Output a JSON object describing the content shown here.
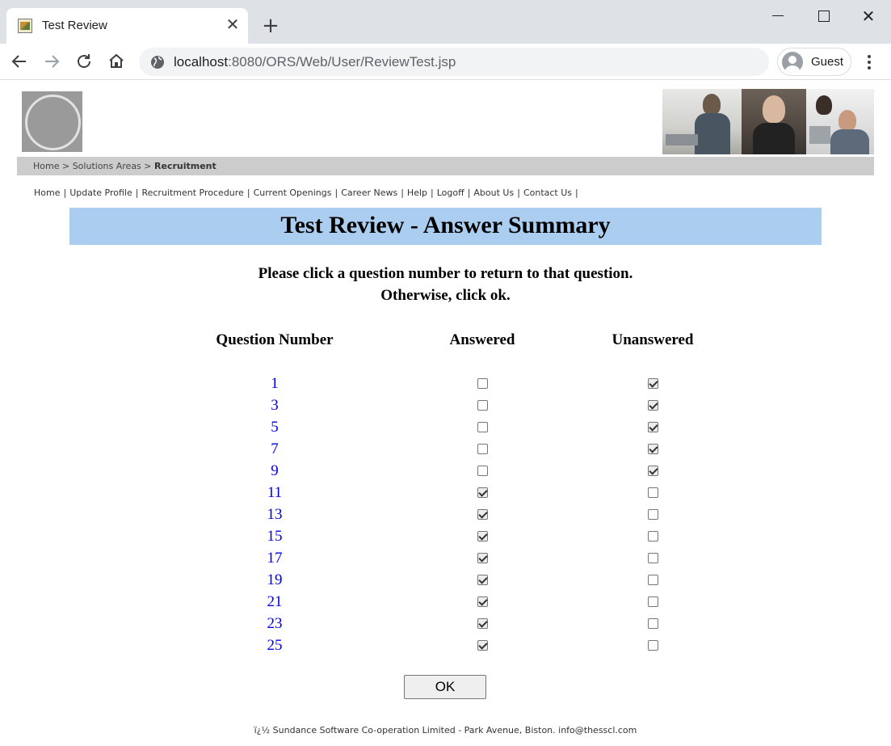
{
  "browser": {
    "tab_title": "Test Review",
    "tab_close": "✕",
    "new_tab": "+",
    "url_host": "localhost",
    "url_rest": ":8080/ORS/Web/User/ReviewTest.jsp",
    "profile_label": "Guest",
    "window_close": "✕"
  },
  "breadcrumb": {
    "home": "Home",
    "separator": ">",
    "solutions": "Solutions Areas",
    "current": "Recruitment"
  },
  "nav": {
    "items": [
      "Home",
      "Update Profile",
      "Recruitment Procedure",
      "Current Openings",
      "Career News",
      "Help",
      "Logoff",
      "About Us",
      "Contact Us"
    ],
    "separator": "|"
  },
  "page": {
    "title": "Test Review - Answer Summary",
    "instruction_1": "Please click a question number to return to that question.",
    "instruction_2": "Otherwise, click ok.",
    "col_question": "Question Number",
    "col_answered": "Answered",
    "col_unanswered": "Unanswered",
    "ok_label": "OK",
    "footer": "ï¿½ Sundance Software Co-operation Limited - Park Avenue, Biston. info@thesscl.com"
  },
  "questions": [
    {
      "number": "1",
      "answered": false
    },
    {
      "number": "3",
      "answered": false
    },
    {
      "number": "5",
      "answered": false
    },
    {
      "number": "7",
      "answered": false
    },
    {
      "number": "9",
      "answered": false
    },
    {
      "number": "11",
      "answered": true
    },
    {
      "number": "13",
      "answered": true
    },
    {
      "number": "15",
      "answered": true
    },
    {
      "number": "17",
      "answered": true
    },
    {
      "number": "19",
      "answered": true
    },
    {
      "number": "21",
      "answered": true
    },
    {
      "number": "23",
      "answered": true
    },
    {
      "number": "25",
      "answered": true
    }
  ],
  "colors": {
    "title_bar": "#abcdf0",
    "link": "#0000ee",
    "breadcrumb_bar": "#cccccc"
  }
}
